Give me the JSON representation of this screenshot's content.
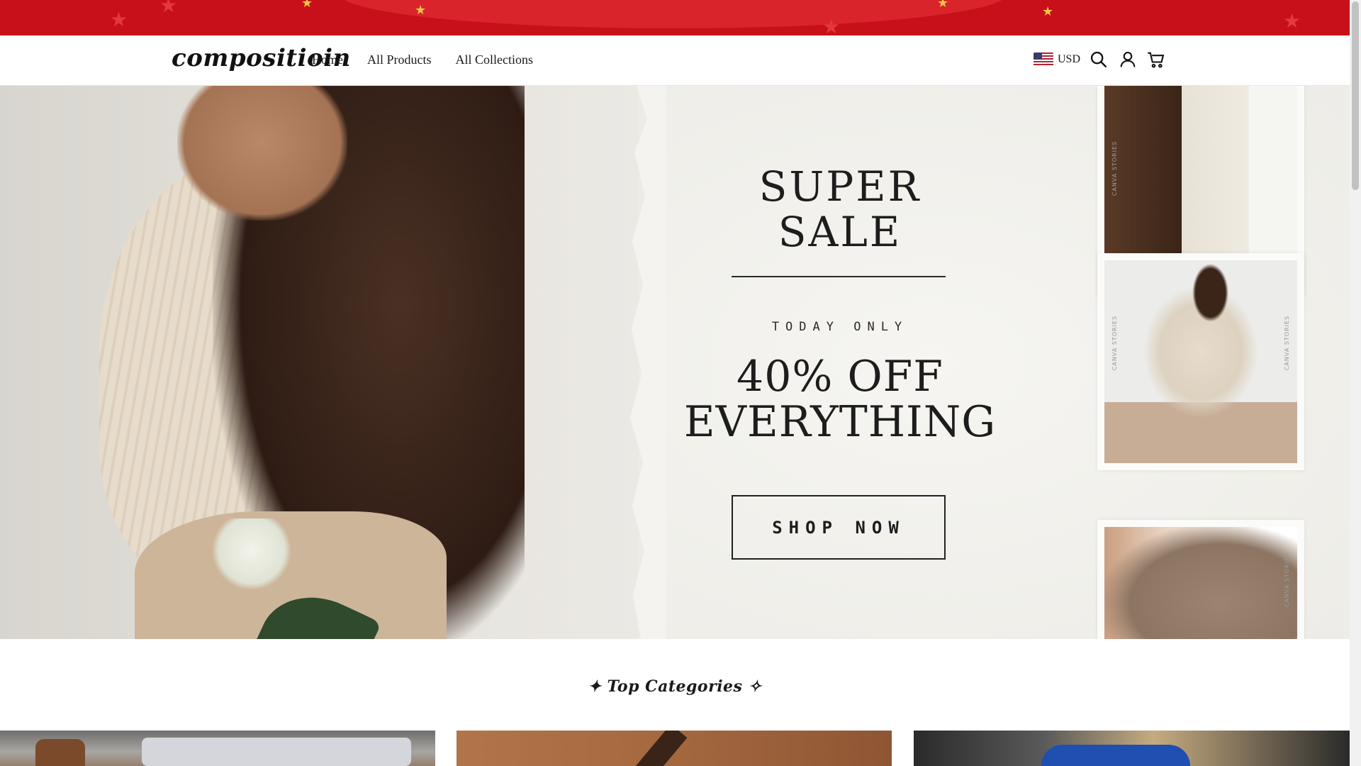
{
  "header": {
    "logo": "compositioin",
    "nav": [
      "Home",
      "All Products",
      "All Collections"
    ],
    "currency": "USD",
    "icons": [
      "search-icon",
      "account-icon",
      "cart-icon"
    ]
  },
  "hero": {
    "title_line1": "SUPER",
    "title_line2": "SALE",
    "subtitle": "TODAY ONLY",
    "offer_line1": "40% OFF",
    "offer_line2": "EVERYTHING",
    "cta": "SHOP NOW",
    "film_text": "CANVA STORIES"
  },
  "categories": {
    "heading": "✦ Top Categories ✧"
  },
  "colors": {
    "promo_red": "#c8101a",
    "star_gold": "#f5c542"
  }
}
